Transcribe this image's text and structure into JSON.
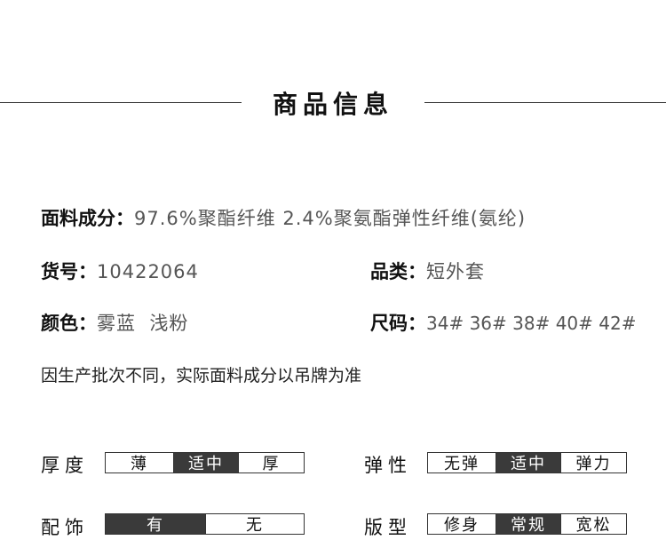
{
  "header": {
    "title": "商品信息"
  },
  "info": {
    "material_label": "面料成分：",
    "material_value": "97.6%聚酯纤维 2.4%聚氨酯弹性纤维(氨纶)",
    "sku_label": "货号：",
    "sku_value": "10422064",
    "category_label": "品类：",
    "category_value": "短外套",
    "color_label": "颜色：",
    "color_value": "雾蓝  浅粉",
    "size_label": "尺码：",
    "size_value": "34# 36# 38# 40# 42#",
    "note": "因生产批次不同，实际面料成分以吊牌为准"
  },
  "attributes": {
    "thickness": {
      "label": "厚度",
      "options": [
        "薄",
        "适中",
        "厚"
      ],
      "selected": 1
    },
    "elasticity": {
      "label": "弹性",
      "options": [
        "无弹",
        "适中",
        "弹力"
      ],
      "selected": 1
    },
    "accessory": {
      "label": "配饰",
      "options": [
        "有",
        "无"
      ],
      "selected": 0
    },
    "fit": {
      "label": "版型",
      "options": [
        "修身",
        "常规",
        "宽松"
      ],
      "selected": 1
    }
  },
  "colors": {
    "selected_bg": "#3a3a3a",
    "line": "#333333"
  }
}
